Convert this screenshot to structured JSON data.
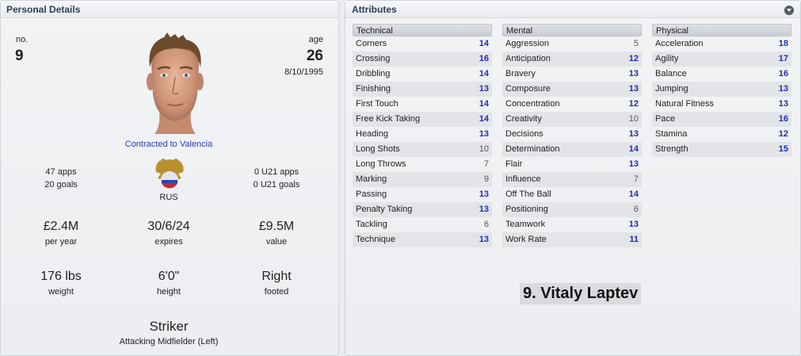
{
  "personal": {
    "title": "Personal Details",
    "no_label": "no.",
    "no_value": "9",
    "age_label": "age",
    "age_value": "26",
    "dob": "8/10/1995",
    "contract": "Contracted to Valencia",
    "apps": "47 apps",
    "goals": "20 goals",
    "nation": "RUS",
    "u21_apps": "0 U21 apps",
    "u21_goals": "0 U21 goals",
    "wage_value": "£2.4M",
    "wage_label": "per year",
    "expires_value": "30/6/24",
    "expires_label": "expires",
    "value_value": "£9.5M",
    "value_label": "value",
    "weight_value": "176 lbs",
    "weight_label": "weight",
    "height_value": "6'0\"",
    "height_label": "height",
    "foot_value": "Right",
    "foot_label": "footed",
    "position": "Striker",
    "secondary_position": "Attacking Midfielder (Left)"
  },
  "attributes": {
    "title": "Attributes",
    "technical": {
      "header": "Technical",
      "rows": [
        {
          "name": "Corners",
          "value": "14"
        },
        {
          "name": "Crossing",
          "value": "16"
        },
        {
          "name": "Dribbling",
          "value": "14"
        },
        {
          "name": "Finishing",
          "value": "13"
        },
        {
          "name": "First Touch",
          "value": "14"
        },
        {
          "name": "Free Kick Taking",
          "value": "14"
        },
        {
          "name": "Heading",
          "value": "13"
        },
        {
          "name": "Long Shots",
          "value": "10"
        },
        {
          "name": "Long Throws",
          "value": "7"
        },
        {
          "name": "Marking",
          "value": "9"
        },
        {
          "name": "Passing",
          "value": "13"
        },
        {
          "name": "Penalty Taking",
          "value": "13"
        },
        {
          "name": "Tackling",
          "value": "6"
        },
        {
          "name": "Technique",
          "value": "13"
        }
      ]
    },
    "mental": {
      "header": "Mental",
      "rows": [
        {
          "name": "Aggression",
          "value": "5"
        },
        {
          "name": "Anticipation",
          "value": "12"
        },
        {
          "name": "Bravery",
          "value": "13"
        },
        {
          "name": "Composure",
          "value": "13"
        },
        {
          "name": "Concentration",
          "value": "12"
        },
        {
          "name": "Creativity",
          "value": "10"
        },
        {
          "name": "Decisions",
          "value": "13"
        },
        {
          "name": "Determination",
          "value": "14"
        },
        {
          "name": "Flair",
          "value": "13"
        },
        {
          "name": "Influence",
          "value": "7"
        },
        {
          "name": "Off The Ball",
          "value": "14"
        },
        {
          "name": "Positioning",
          "value": "6"
        },
        {
          "name": "Teamwork",
          "value": "13"
        },
        {
          "name": "Work Rate",
          "value": "11"
        }
      ]
    },
    "physical": {
      "header": "Physical",
      "rows": [
        {
          "name": "Acceleration",
          "value": "18"
        },
        {
          "name": "Agility",
          "value": "17"
        },
        {
          "name": "Balance",
          "value": "16"
        },
        {
          "name": "Jumping",
          "value": "13"
        },
        {
          "name": "Natural Fitness",
          "value": "13"
        },
        {
          "name": "Pace",
          "value": "16"
        },
        {
          "name": "Stamina",
          "value": "12"
        },
        {
          "name": "Strength",
          "value": "15"
        }
      ]
    }
  },
  "player_name": "9. Vitaly Laptev",
  "colors": {
    "accent_blue": "#1c2fb3",
    "title_text": "#2c3e57",
    "contract_link": "#2b3bb0"
  }
}
